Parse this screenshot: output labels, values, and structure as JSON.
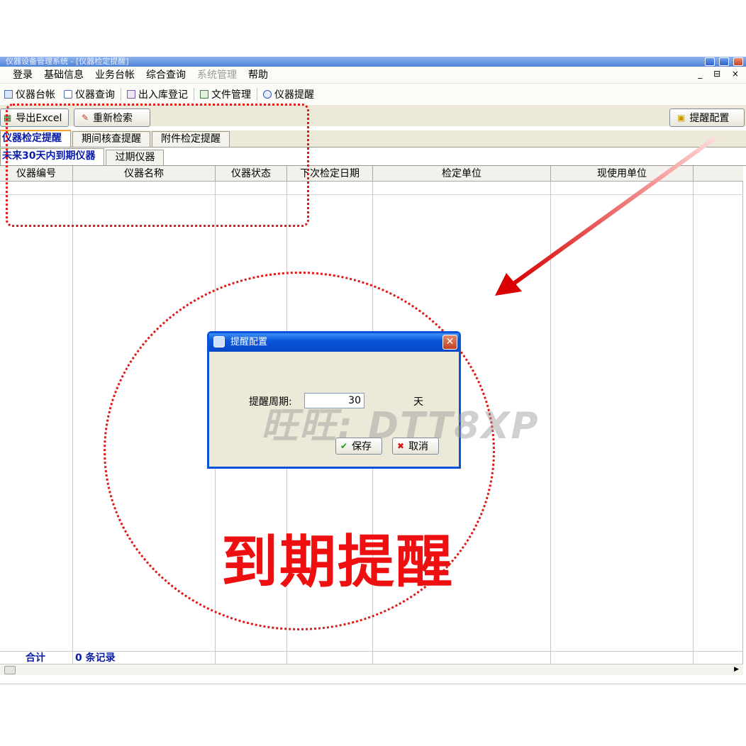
{
  "window": {
    "title": "仪器设备管理系统 - [仪器检定提醒]",
    "mdi_controls": "_ ⊟ ×"
  },
  "menu": [
    "登录",
    "基础信息",
    "业务台帐",
    "综合查询",
    "系统管理",
    "帮助"
  ],
  "toolbar": [
    {
      "label": "仪器台帐",
      "icon": "ledger-icon"
    },
    {
      "label": "仪器查询",
      "icon": "search-doc-icon"
    },
    {
      "label": "出入库登记",
      "icon": "inout-icon"
    },
    {
      "label": "文件管理",
      "icon": "file-icon"
    },
    {
      "label": "仪器提醒",
      "icon": "info-icon"
    }
  ],
  "actions": {
    "export_label": "导出Excel",
    "refresh_label": "重新检索",
    "config_label": "提醒配置"
  },
  "main_tabs": [
    "仪器检定提醒",
    "期间核查提醒",
    "附件检定提醒"
  ],
  "sub_tabs": [
    "未来30天内到期仪器",
    "过期仪器"
  ],
  "grid": {
    "columns": [
      "仪器编号",
      "仪器名称",
      "仪器状态",
      "下次检定日期",
      "检定单位",
      "现使用单位"
    ],
    "rows": [],
    "footer_label": "合计",
    "footer_count": "0 条记录"
  },
  "dialog": {
    "title": "提醒配置",
    "field_label": "提醒周期:",
    "field_value": "30",
    "unit": "天",
    "save_label": "保存",
    "cancel_label": "取消"
  },
  "annotations": {
    "watermark": "旺旺: DTT8XP",
    "headline": "到期提醒"
  },
  "colors": {
    "accent_red": "#ee1010",
    "xp_blue": "#0a53d8",
    "tab_active_text": "#0a1ca8"
  }
}
